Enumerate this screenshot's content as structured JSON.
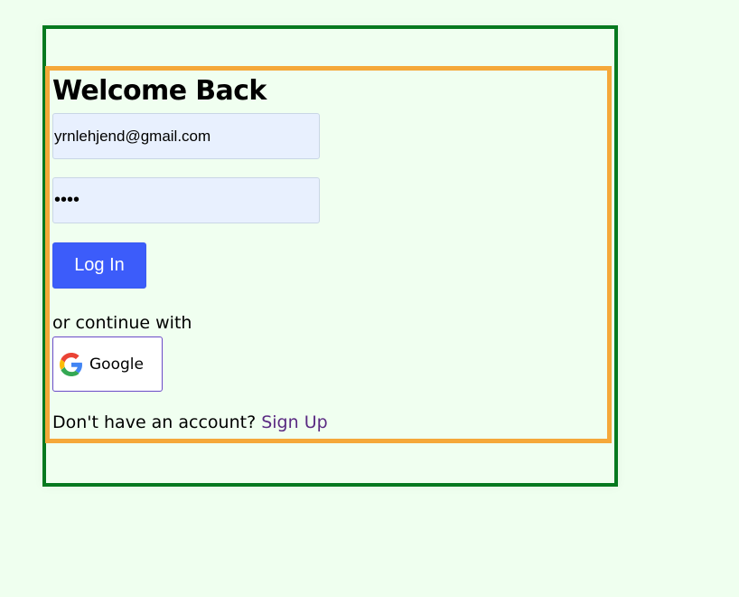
{
  "login": {
    "title": "Welcome Back",
    "email_value": "yrnlehjend@gmail.com",
    "password_value": "••••",
    "login_label": "Log In",
    "continue_text": "or continue with",
    "google_label": "Google",
    "signup_prompt": "Don't have an account?",
    "signup_link": "Sign Up"
  },
  "colors": {
    "outer_border": "#06791f",
    "inner_border": "#f5a83a",
    "background": "#efffef",
    "input_bg": "#e8f0fe",
    "button_bg": "#3c5cfa",
    "link": "#5a2a82"
  },
  "icons": {
    "google": "google-logo-icon"
  }
}
